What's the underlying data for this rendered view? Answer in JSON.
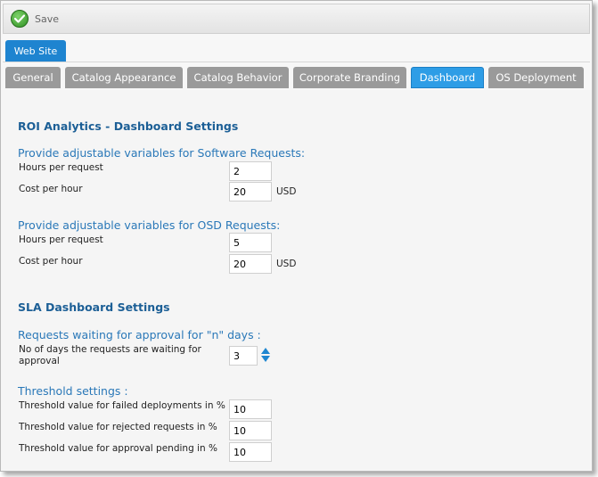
{
  "toolbar": {
    "save_label": "Save"
  },
  "outer_tab": "Web Site",
  "tabs": [
    "General",
    "Catalog Appearance",
    "Catalog Behavior",
    "Corporate Branding",
    "Dashboard",
    "OS Deployment"
  ],
  "active_tab": "Dashboard",
  "roi": {
    "title": "ROI Analytics - Dashboard Settings",
    "software": {
      "heading": "Provide adjustable variables for Software Requests:",
      "hours_label": "Hours per request",
      "hours_value": "2",
      "cost_label": "Cost per hour",
      "cost_value": "20",
      "unit": "USD"
    },
    "osd": {
      "heading": "Provide adjustable variables for OSD Requests:",
      "hours_label": "Hours per request",
      "hours_value": "5",
      "cost_label": "Cost per hour",
      "cost_value": "20",
      "unit": "USD"
    }
  },
  "sla": {
    "title": "SLA Dashboard Settings",
    "waiting": {
      "heading": "Requests waiting for approval for \"n\" days :",
      "label": "No of days the requests are waiting for approval",
      "value": "3"
    },
    "threshold": {
      "heading": "Threshold settings :",
      "failed_label": "Threshold value for failed deployments in %",
      "failed_value": "10",
      "rejected_label": "Threshold value for rejected requests in %",
      "rejected_value": "10",
      "pending_label": "Threshold value for approval pending in %",
      "pending_value": "10"
    }
  }
}
